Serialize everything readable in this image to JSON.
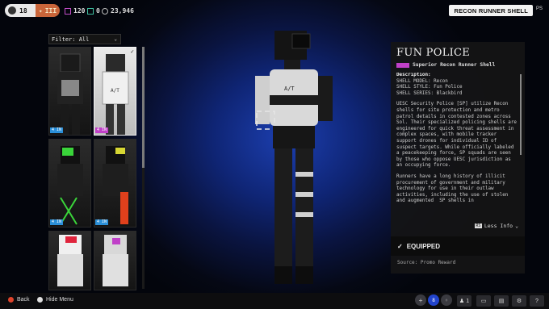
{
  "topbar": {
    "rank": "18",
    "faction_label": "III",
    "currencies": [
      {
        "value": "120",
        "color": "#c14dc7",
        "icon": "purple-square-icon"
      },
      {
        "value": "0",
        "color": "#3fbfa0",
        "icon": "teal-square-icon"
      },
      {
        "value": "23,946",
        "color": "#bbbbbb",
        "icon": "credit-icon"
      }
    ],
    "shell_tag": "RECON RUNNER SHELL",
    "ps": "PS"
  },
  "filter": {
    "label": "Filter: All"
  },
  "grid": {
    "cards": [
      {
        "tag": "4 IN",
        "tag_color": "#2b8fd8",
        "selected": false
      },
      {
        "tag": "4 IN",
        "tag_color": "#c040c8",
        "selected": true
      },
      {
        "tag": "4 IN",
        "tag_color": "#2b8fd8",
        "selected": false
      },
      {
        "tag": "4 IN",
        "tag_color": "#2b8fd8",
        "selected": false
      },
      {
        "tag": "",
        "tag_color": "#2b8fd8",
        "selected": false
      },
      {
        "tag": "",
        "tag_color": "#2b8fd8",
        "selected": false
      }
    ]
  },
  "details": {
    "title": "FUN POLICE",
    "subtitle": "Superior Recon Runner Shell",
    "description_heading": "Description:",
    "model": "SHELL MODEL: Recon",
    "style": "SHELL STYLE: Fun Police",
    "series": "SHELL SERIES: Blackbird",
    "para1": "UESC Security Police [SP] utilize Recon shells for site protection and metro patrol details in contested zones across Sol. Their specialized policing shells are engineered for quick threat assessment in complex spaces, with mobile tracker support drones for individual ID of suspect targets. While officially labeled a peacekeeping force, SP squads are seen by those who oppose UESC jurisdiction as an occupying force.",
    "para2": "Runners have a long history of illicit procurement of government and military technology for use in their outlaw activities, including the use of stolen and augmented  SP shells in",
    "less_key": "RS",
    "less_info": "Less Info",
    "equipped": "EQUIPPED",
    "source": "Source: Promo Reward"
  },
  "bottombar": {
    "back": "Back",
    "hide_menu": "Hide Menu",
    "notif_count": "8",
    "party_count": "1",
    "help": "?"
  },
  "colors": {
    "accent_purple": "#c040c8",
    "bg_blue": "#1c3fb0"
  }
}
